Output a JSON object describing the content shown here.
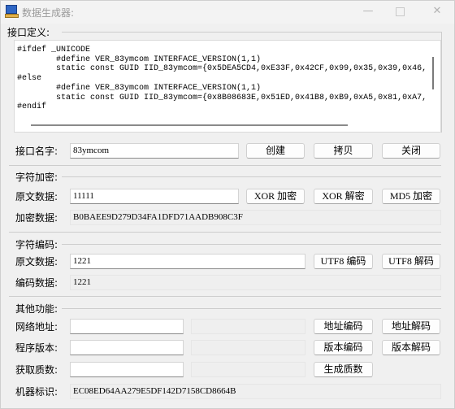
{
  "window": {
    "title": "数据生成器:",
    "minimize_glyph": "—",
    "close_glyph": "✕"
  },
  "interface": {
    "group_label": "接口定义:",
    "code": "#ifdef _UNICODE\n        #define VER_83ymcom INTERFACE_VERSION(1,1)\n        static const GUID IID_83ymcom={0x5DEA5CD4,0xE33F,0x42CF,0x99,0x35,0x39,0x46,\n#else\n        #define VER_83ymcom INTERFACE_VERSION(1,1)\n        static const GUID IID_83ymcom={0x8B08683E,0x51ED,0x41B8,0xB9,0xA5,0x81,0xA7,\n#endif",
    "name_label": "接口名字:",
    "name_value": "83ymcom",
    "create_button": "创建",
    "copy_button": "拷贝",
    "close_button": "关闭"
  },
  "encryption": {
    "group_label": "字符加密:",
    "source_label": "原文数据:",
    "source_value": "11111",
    "xor_encrypt_button": "XOR 加密",
    "xor_decrypt_button": "XOR 解密",
    "md5_button": "MD5 加密",
    "result_label": "加密数据:",
    "result_value": "B0BAEE9D279D34FA1DFD71AADB908C3F"
  },
  "encoding": {
    "group_label": "字符编码:",
    "source_label": "原文数据:",
    "source_value": "1221",
    "utf8_encode_button": "UTF8 编码",
    "utf8_decode_button": "UTF8 解码",
    "result_label": "编码数据:",
    "result_value": "1221"
  },
  "other": {
    "group_label": "其他功能:",
    "url_label": "网络地址:",
    "url_value": "",
    "url_output": "",
    "url_encode_button": "地址编码",
    "url_decode_button": "地址解码",
    "version_label": "程序版本:",
    "version_value": "",
    "version_output": "",
    "version_encode_button": "版本编码",
    "version_decode_button": "版本解码",
    "prime_label": "获取质数:",
    "prime_value": "",
    "prime_output": "",
    "prime_button": "生成质数",
    "machine_label": "机器标识:",
    "machine_value": "EC08ED64AA279E5DF142D7158CD8664B"
  }
}
